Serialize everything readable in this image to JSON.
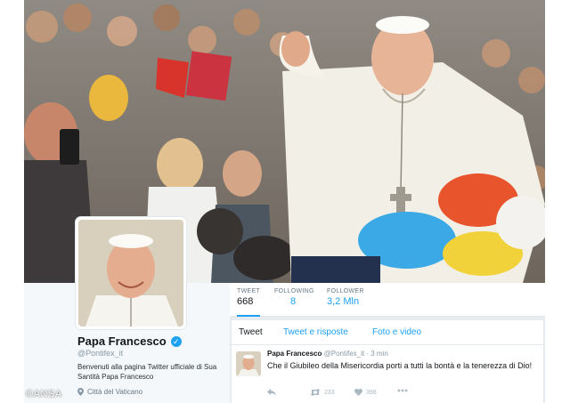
{
  "profile": {
    "name": "Papa Francesco",
    "handle": "@Pontifex_it",
    "bio": "Benvenuti alla pagina Twitter ufficiale di Sua Santità Papa Francesco",
    "location": "Città del Vaticano"
  },
  "stats": [
    {
      "label": "TWEET",
      "value": "668"
    },
    {
      "label": "FOLLOWING",
      "value": "8"
    },
    {
      "label": "FOLLOWER",
      "value": "3,2 Mln"
    }
  ],
  "tabs": [
    "Tweet",
    "Tweet e risposte",
    "Foto e video"
  ],
  "tweet": {
    "name": "Papa Francesco",
    "handle": "@Pontifex_it",
    "time": "· 3 min",
    "text": "Che il Giubileo della Misericordia porti a tutti la bontà e la tenerezza di Dio!",
    "retweets": "233",
    "likes": "398"
  },
  "watermark": "©ANSA",
  "colors": {
    "accent": "#1da1f2",
    "page_bg": "#e6ecf0"
  }
}
